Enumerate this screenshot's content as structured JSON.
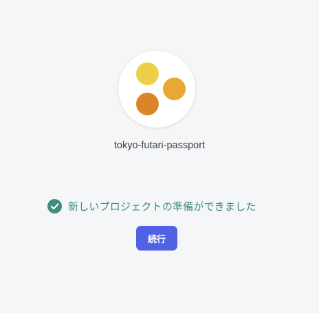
{
  "project": {
    "name": "tokyo-futari-passport",
    "logo_dot_colors": [
      "#edd047",
      "#e9a834",
      "#db852a"
    ]
  },
  "status": {
    "icon": "check-circle-icon",
    "message": "新しいプロジェクトの準備ができました",
    "color": "#3e8d7d"
  },
  "actions": {
    "continue_label": "続行",
    "continue_color": "#5061e3"
  }
}
